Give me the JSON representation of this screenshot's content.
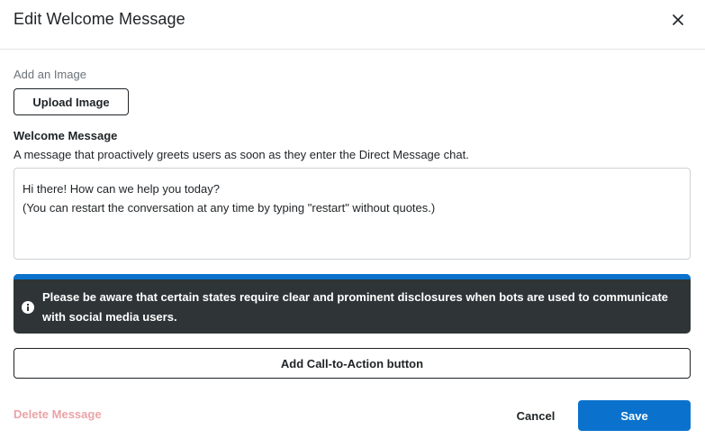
{
  "dialog": {
    "title": "Edit Welcome Message",
    "close_icon": "close-icon"
  },
  "image_section": {
    "label": "Add an Image",
    "upload_label": "Upload Image"
  },
  "welcome_message": {
    "title": "Welcome Message",
    "description": "A message that proactively greets users as soon as they enter the Direct Message chat.",
    "line1": "Hi there! How can we help you today?",
    "line2": "",
    "line3": "(You can restart the conversation at any time by typing \"restart\" without quotes.)"
  },
  "notice": {
    "icon": "info-icon",
    "text": "Please be aware that certain states require clear and prominent disclosures when bots are used to communicate with social media users.",
    "accent_color": "#0a72cc",
    "background_color": "#2f3537"
  },
  "actions": {
    "cta_label": "Add Call-to-Action button",
    "delete_label": "Delete Message",
    "cancel_label": "Cancel",
    "save_label": "Save",
    "save_color": "#0a72cc",
    "delete_color": "#eaa3a8"
  }
}
